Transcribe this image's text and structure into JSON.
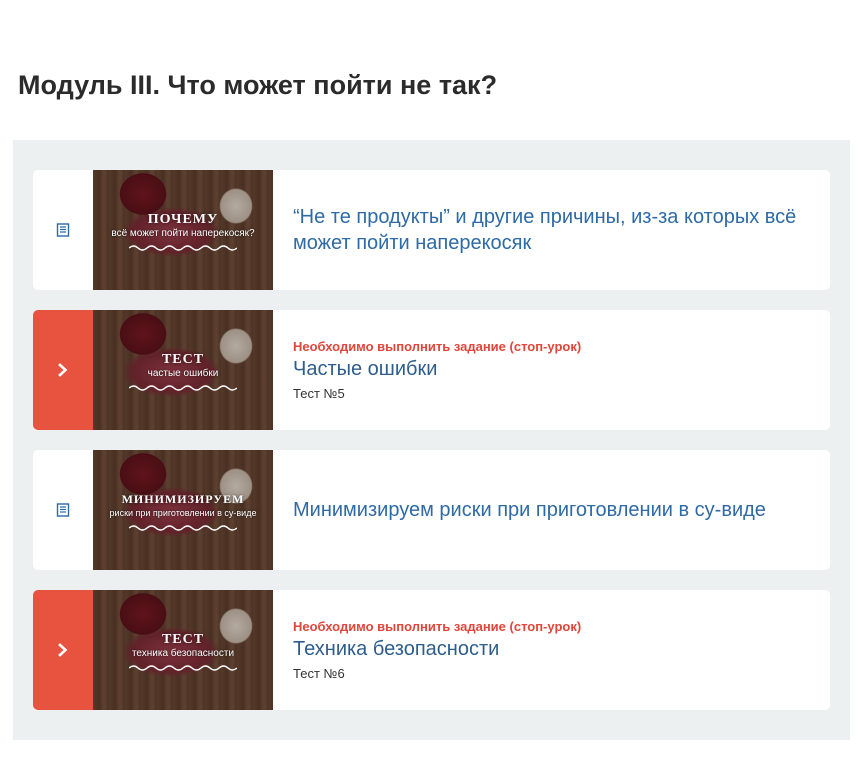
{
  "module": {
    "title": "Модуль III. Что может пойти не так?"
  },
  "lessons": [
    {
      "kind": "text",
      "icon": "document-icon",
      "thumb_title": "Почему",
      "thumb_subtitle": "всё может пойти наперекосяк?",
      "title": "“Не те продукты” и другие причины, из-за которых всё может пойти наперекосяк"
    },
    {
      "kind": "stop",
      "icon": "chevron-right-icon",
      "thumb_title": "Тест",
      "thumb_subtitle": "частые ошибки",
      "stop_label": "Необходимо выполнить задание (стоп-урок)",
      "title": "Частые ошибки",
      "test_label": "Тест №5"
    },
    {
      "kind": "text",
      "icon": "document-icon",
      "thumb_title": "Минимизируем",
      "thumb_subtitle": "риски при приготовлении в су-виде",
      "title": "Минимизируем риски при приготовлении в су-виде"
    },
    {
      "kind": "stop",
      "icon": "chevron-right-icon",
      "thumb_title": "Тест",
      "thumb_subtitle": "техника безопасности",
      "stop_label": "Необходимо выполнить задание (стоп-урок)",
      "title": "Техника безопасности",
      "test_label": "Тест №6"
    }
  ],
  "colors": {
    "panel_bg": "#edf0f1",
    "stop_accent": "#e8533f",
    "link_blue": "#2e6aa5",
    "warning_red": "#e2463a"
  }
}
